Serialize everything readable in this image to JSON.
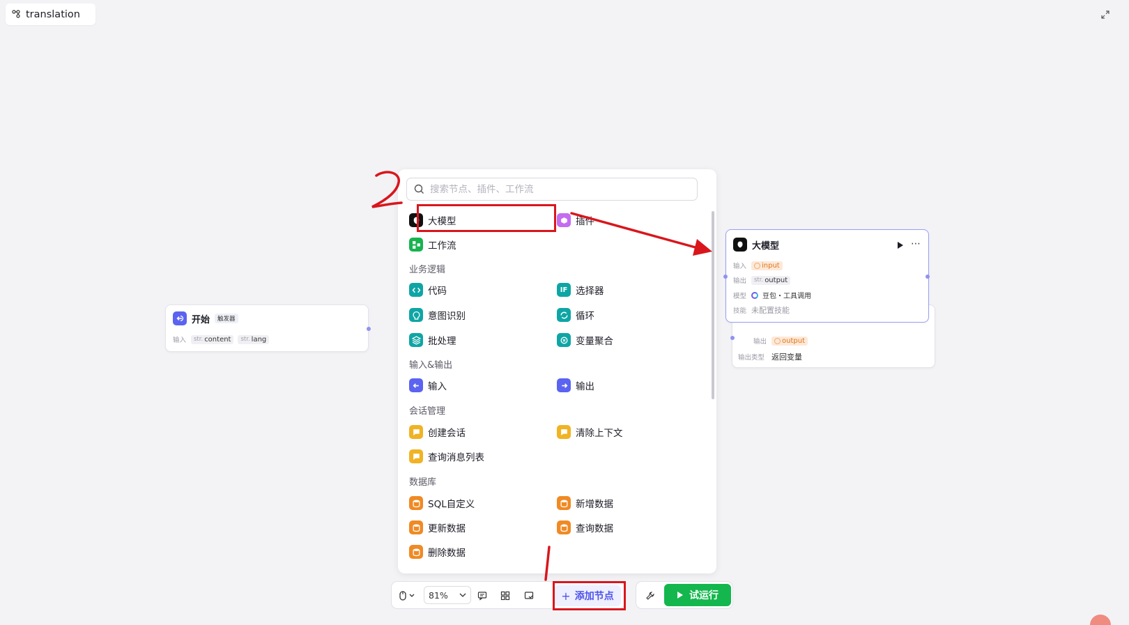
{
  "header": {
    "title": "translation"
  },
  "nodes": {
    "start": {
      "title": "开始",
      "badge": "触发器",
      "input_key": "输入",
      "params": [
        {
          "type": "str.",
          "name": "content"
        },
        {
          "type": "str.",
          "name": "lang"
        }
      ]
    },
    "llm": {
      "title": "大模型",
      "rows": {
        "input_key": "输入",
        "input_val": "input",
        "output_key": "输出",
        "output_type": "str.",
        "output_val": "output",
        "model_key": "模型",
        "model_val": "豆包・工具调用",
        "skill_key": "技能",
        "skill_val": "未配置技能"
      }
    },
    "end": {
      "output_key": "输出",
      "output_val": "output",
      "type_key": "输出类型",
      "type_val": "返回变量"
    }
  },
  "panel": {
    "search_placeholder": "搜索节点、插件、工作流",
    "top_items": [
      "大模型",
      "插件",
      "工作流"
    ],
    "sections": [
      {
        "title": "业务逻辑",
        "items": [
          "代码",
          "选择器",
          "意图识别",
          "循环",
          "批处理",
          "变量聚合"
        ]
      },
      {
        "title": "输入&输出",
        "items": [
          "输入",
          "输出"
        ]
      },
      {
        "title": "会话管理",
        "items": [
          "创建会话",
          "清除上下文",
          "查询消息列表"
        ]
      },
      {
        "title": "数据库",
        "items": [
          "SQL自定义",
          "新增数据",
          "更新数据",
          "查询数据",
          "删除数据"
        ]
      }
    ]
  },
  "toolbar": {
    "zoom": "81%",
    "add_node": "添加节点",
    "test_run": "试运行"
  },
  "annotations": {
    "step1": "1",
    "step2": "2"
  },
  "colors": {
    "accent": "#4d53e8",
    "run": "#14b74d",
    "annotation": "#d9161c"
  }
}
